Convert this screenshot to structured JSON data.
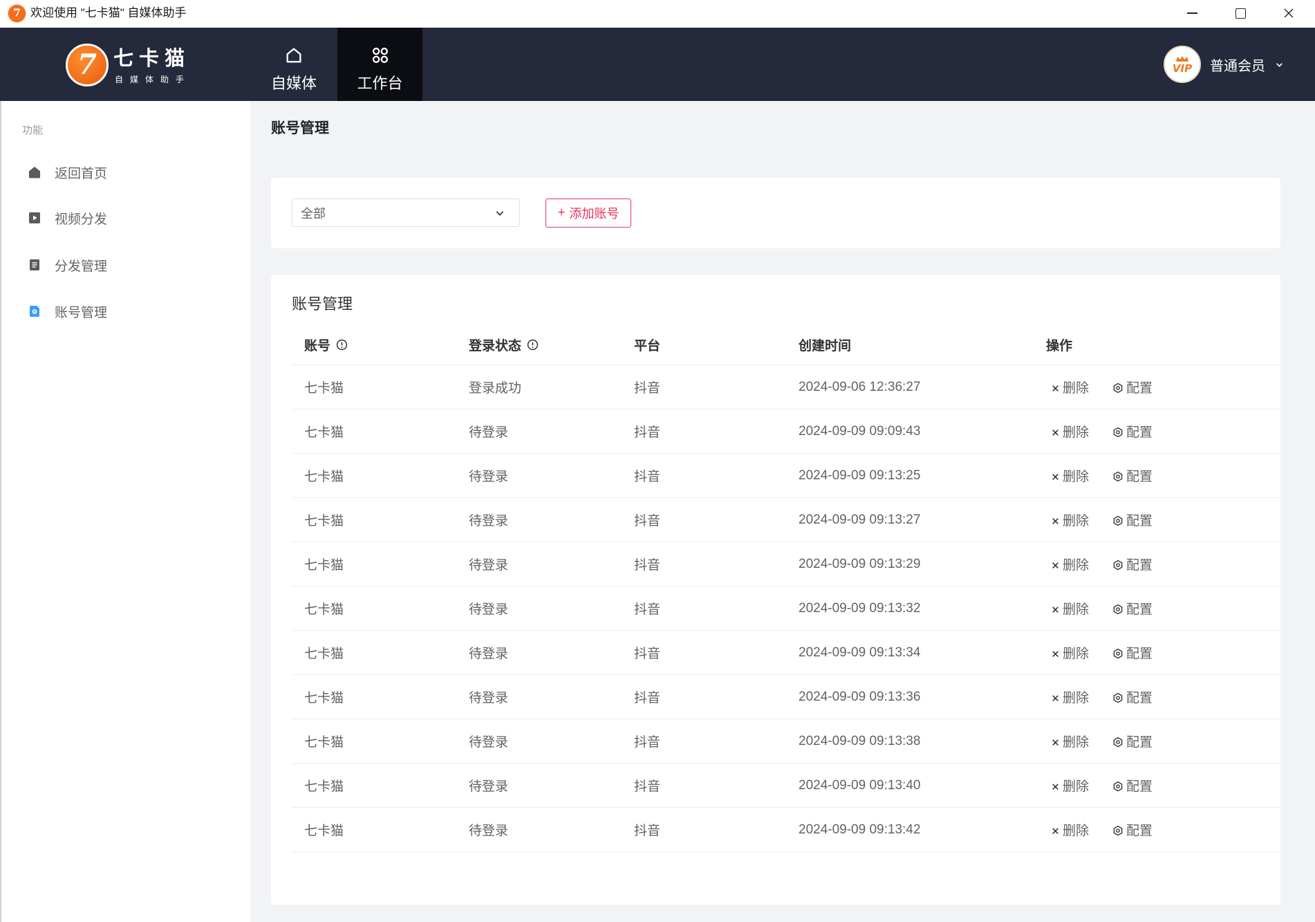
{
  "window": {
    "app_icon": "7",
    "title": "欢迎使用 \"七卡猫\" 自媒体助手",
    "controls": [
      "minimize-icon",
      "maximize-icon",
      "close-icon"
    ]
  },
  "header": {
    "logo": {
      "mark": "7",
      "name": "七卡猫",
      "tagline": "自媒体助手"
    },
    "nav": [
      {
        "label": "自媒体",
        "icon": "home-icon",
        "active": false
      },
      {
        "label": "工作台",
        "icon": "grid-icon",
        "active": true
      }
    ],
    "user": {
      "badge": "VIP",
      "level": "普通会员",
      "icon": "chevron-down-icon"
    }
  },
  "sidebar": {
    "section_label": "功能",
    "items": [
      {
        "label": "返回首页",
        "icon": "home-filled-icon",
        "active": false
      },
      {
        "label": "视频分发",
        "icon": "play-square-icon",
        "active": false
      },
      {
        "label": "分发管理",
        "icon": "document-icon",
        "active": false
      },
      {
        "label": "账号管理",
        "icon": "file-settings-icon",
        "active": true
      }
    ]
  },
  "page": {
    "title": "账号管理"
  },
  "filter": {
    "select_value": "全部",
    "add_button": {
      "icon": "+",
      "label": "添加账号"
    }
  },
  "table": {
    "title": "账号管理",
    "columns": [
      {
        "label": "账号",
        "info_icon": true
      },
      {
        "label": "登录状态",
        "info_icon": true
      },
      {
        "label": "平台"
      },
      {
        "label": "创建时间"
      },
      {
        "label": "操作"
      }
    ],
    "actions": {
      "delete": "删除",
      "config": "配置"
    },
    "rows": [
      {
        "account": "七卡猫",
        "status": "登录成功",
        "platform": "抖音",
        "created": "2024-09-06 12:36:27"
      },
      {
        "account": "七卡猫",
        "status": "待登录",
        "platform": "抖音",
        "created": "2024-09-09 09:09:43"
      },
      {
        "account": "七卡猫",
        "status": "待登录",
        "platform": "抖音",
        "created": "2024-09-09 09:13:25"
      },
      {
        "account": "七卡猫",
        "status": "待登录",
        "platform": "抖音",
        "created": "2024-09-09 09:13:27"
      },
      {
        "account": "七卡猫",
        "status": "待登录",
        "platform": "抖音",
        "created": "2024-09-09 09:13:29"
      },
      {
        "account": "七卡猫",
        "status": "待登录",
        "platform": "抖音",
        "created": "2024-09-09 09:13:32"
      },
      {
        "account": "七卡猫",
        "status": "待登录",
        "platform": "抖音",
        "created": "2024-09-09 09:13:34"
      },
      {
        "account": "七卡猫",
        "status": "待登录",
        "platform": "抖音",
        "created": "2024-09-09 09:13:36"
      },
      {
        "account": "七卡猫",
        "status": "待登录",
        "platform": "抖音",
        "created": "2024-09-09 09:13:38"
      },
      {
        "account": "七卡猫",
        "status": "待登录",
        "platform": "抖音",
        "created": "2024-09-09 09:13:40"
      },
      {
        "account": "七卡猫",
        "status": "待登录",
        "platform": "抖音",
        "created": "2024-09-09 09:13:42"
      }
    ]
  },
  "colors": {
    "header_bg": "#242a3b",
    "nav_active_bg": "#0b0d12",
    "brand_orange": "#f26a1b",
    "accent_red": "#e6365c",
    "active_icon_blue": "#3d9cf5",
    "content_bg": "#f2f3f5"
  }
}
